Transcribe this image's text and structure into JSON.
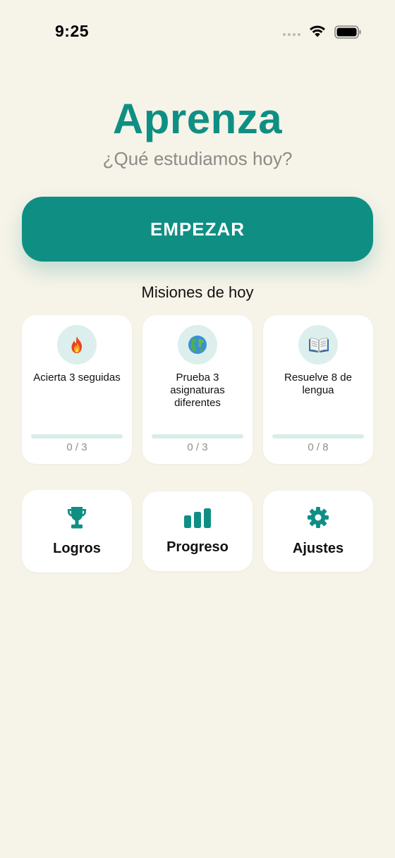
{
  "status_bar": {
    "time": "9:25"
  },
  "header": {
    "title": "Aprenza",
    "subtitle": "¿Qué estudiamos hoy?"
  },
  "start_button": {
    "label": "EMPEZAR"
  },
  "missions": {
    "heading": "Misiones de hoy",
    "items": [
      {
        "icon": "fire-icon",
        "text": "Acierta 3 seguidas",
        "progress_text": "0 / 3",
        "progress": 0
      },
      {
        "icon": "globe-icon",
        "text": "Prueba 3 asignaturas diferentes",
        "progress_text": "0 / 3",
        "progress": 0
      },
      {
        "icon": "open-book-icon",
        "text": "Resuelve 8 de lengua",
        "progress_text": "0 / 8",
        "progress": 0
      }
    ]
  },
  "nav": {
    "items": [
      {
        "icon": "trophy-icon",
        "label": "Logros"
      },
      {
        "icon": "bar-chart-icon",
        "label": "Progreso"
      },
      {
        "icon": "gear-icon",
        "label": "Ajustes"
      }
    ]
  },
  "colors": {
    "background": "#f6f3e8",
    "accent": "#0f8f84",
    "card": "#ffffff",
    "progress_track": "#d9ece9",
    "muted_text": "#8b8b87"
  }
}
